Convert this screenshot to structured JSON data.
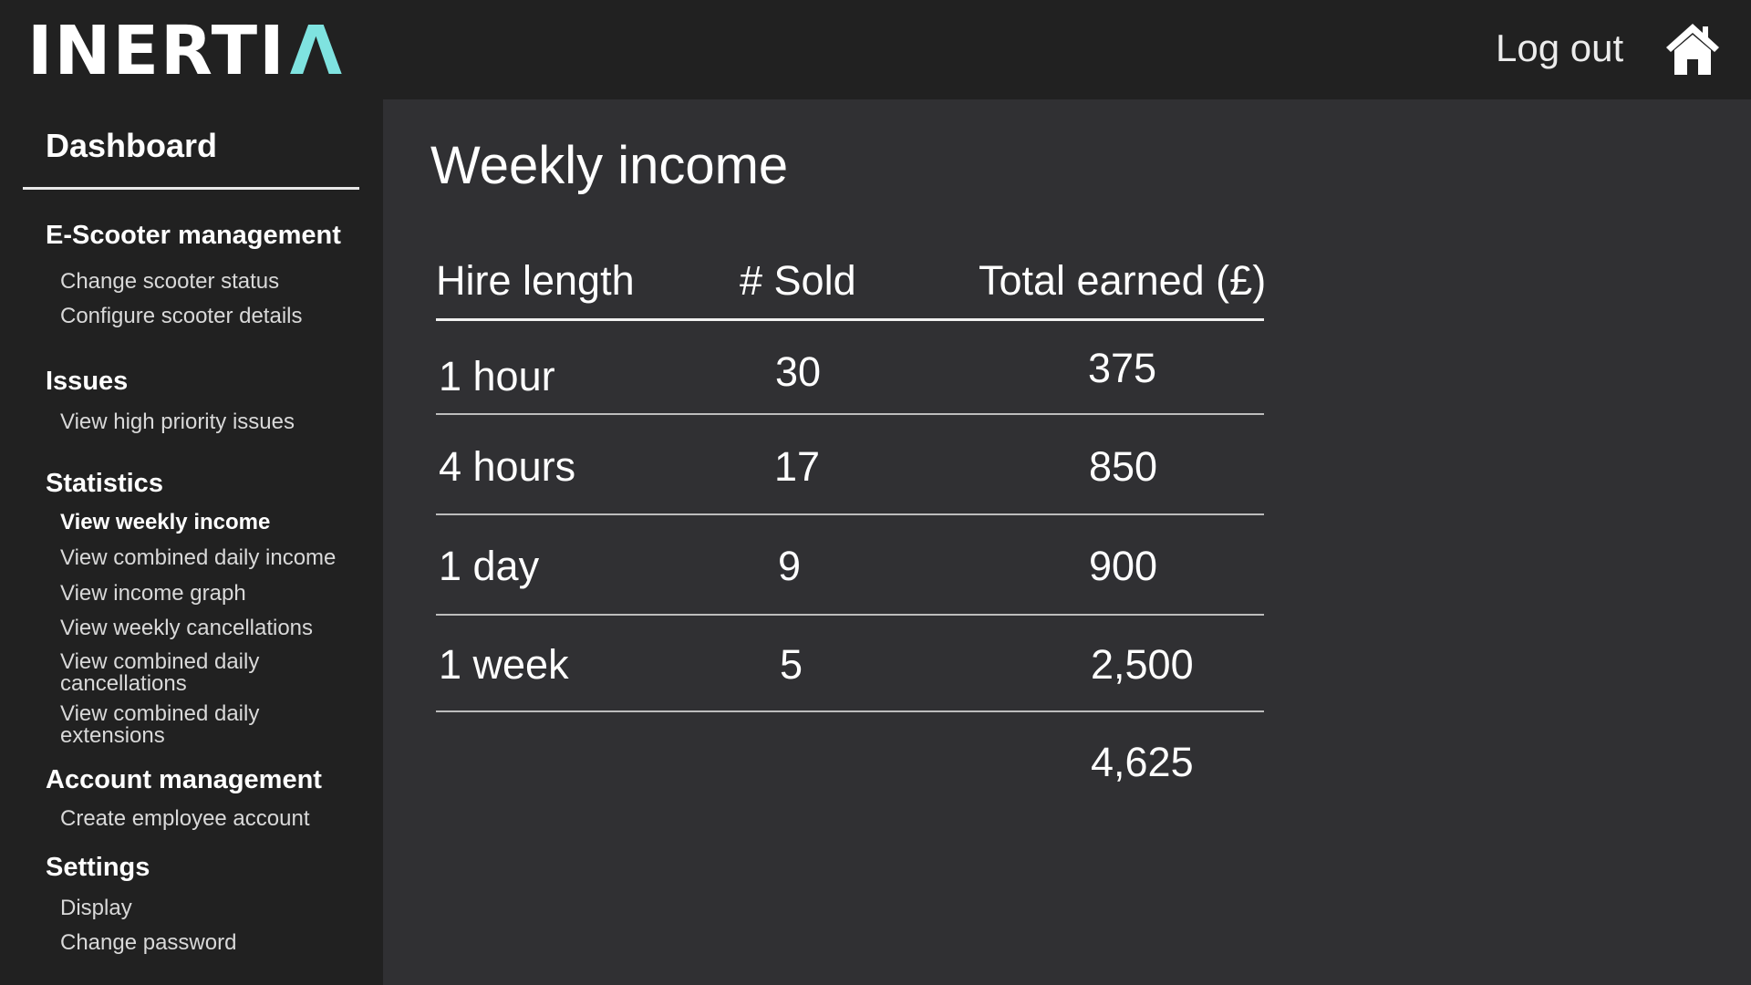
{
  "app": {
    "logo_main": "INERTI",
    "logo_accent": "Λ",
    "logout_label": "Log out",
    "home_icon": "home-icon"
  },
  "sidebar": {
    "dashboard_label": "Dashboard",
    "sections": [
      {
        "title": "E-Scooter management",
        "items": [
          "Change scooter status",
          "Configure scooter details"
        ]
      },
      {
        "title": "Issues",
        "items": [
          "View high priority issues"
        ]
      },
      {
        "title": "Statistics",
        "items": [
          "View weekly income",
          "View combined daily income",
          "View income graph",
          "View weekly cancellations",
          "View combined daily cancellations",
          "View combined daily extensions"
        ]
      },
      {
        "title": "Account management",
        "items": [
          "Create employee account"
        ]
      },
      {
        "title": "Settings",
        "items": [
          "Display",
          "Change password"
        ]
      }
    ],
    "active_item": "View weekly income"
  },
  "main": {
    "title": "Weekly income",
    "table": {
      "headers": [
        "Hire length",
        "# Sold",
        "Total earned (£)"
      ],
      "rows": [
        [
          "1 hour",
          "30",
          "375"
        ],
        [
          "4 hours",
          "17",
          "850"
        ],
        [
          "1 day",
          "9",
          "900"
        ],
        [
          "1 week",
          "5",
          "2,500"
        ]
      ],
      "total": "4,625"
    }
  },
  "colors": {
    "topbar_bg": "#212121",
    "sidebar_bg": "#212121",
    "main_bg": "#303033",
    "logo_accent": "#7fe3e0"
  }
}
